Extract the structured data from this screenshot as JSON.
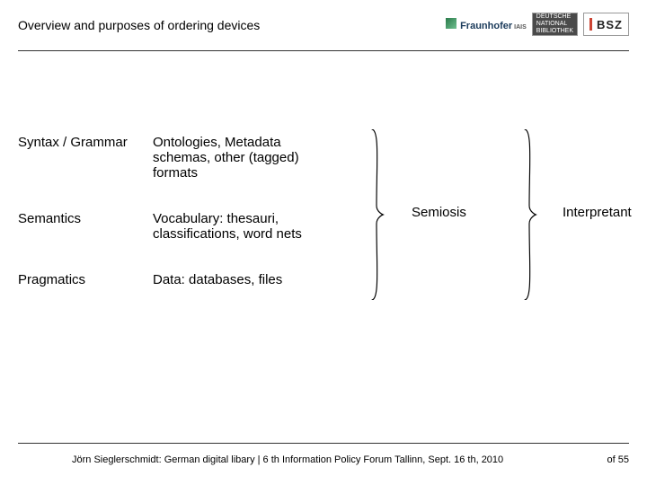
{
  "header": {
    "title": "Overview and purposes of ordering devices",
    "logos": {
      "fraunhofer": "Fraunhofer",
      "fraunhofer_sub": "IAIS",
      "dnb_l1": "DEUTSCHE",
      "dnb_l2": "NATIONAL",
      "dnb_l3": "BIBLIOTHEK",
      "bsz": "BSZ"
    }
  },
  "rows": [
    {
      "left": "Syntax / Grammar",
      "mid": "Ontologies, Metadata schemas, other (tagged) formats"
    },
    {
      "left": "Semantics",
      "mid": "Vocabulary: thesauri, classifications, word nets"
    },
    {
      "left": "Pragmatics",
      "mid": "Data: databases, files"
    }
  ],
  "labels": {
    "semiosis": "Semiosis",
    "interpretant": "Interpretant"
  },
  "footer": {
    "citation": "Jörn Sieglerschmidt: German digital libary | 6 th Information Policy Forum Tallinn, Sept. 16 th, 2010",
    "page": "of 55"
  }
}
